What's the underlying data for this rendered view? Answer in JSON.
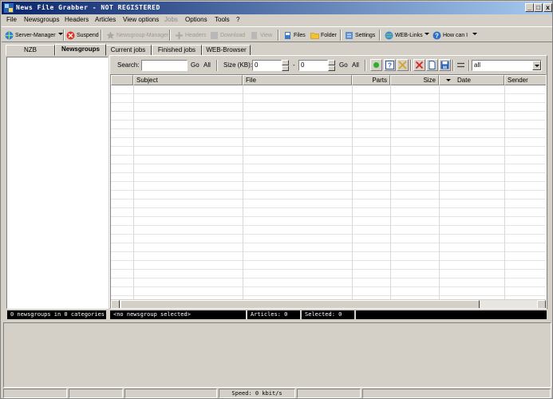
{
  "window": {
    "title": "News File Grabber - NOT REGISTERED",
    "min_label": "_",
    "max_label": "□",
    "close_label": "x"
  },
  "menu": [
    "File",
    "Newsgroups",
    "Headers",
    "Articles",
    "View options",
    "Jobs",
    "Options",
    "Tools",
    "?"
  ],
  "toolbar": {
    "server_manager": "Server-Manager",
    "suspend": "Suspend",
    "newsgroup_manager": "Newsgroup-Manager",
    "headers": "Headers",
    "download": "Download",
    "view": "View",
    "files": "Files",
    "folder": "Folder",
    "settings": "Settings",
    "web_links": "WEB-Links",
    "how_can_i": "How can I"
  },
  "left_tabs": [
    "NZB",
    "Newsgroups"
  ],
  "right_tabs": [
    "Current jobs",
    "Finished jobs",
    "WEB-Browser"
  ],
  "filter": {
    "search_label": "Search:",
    "search_value": "",
    "go1": "Go",
    "all1": "All",
    "size_label": "Size (KB):",
    "size_from": "0",
    "dash": "-",
    "size_to": "0",
    "go2": "Go",
    "all2": "All",
    "select_value": "all"
  },
  "grid": {
    "columns": [
      "Subject",
      "File",
      "Parts",
      "Size",
      "Date",
      "Sender"
    ]
  },
  "status_panels": {
    "newsgroups": "0 newsgroups in 0 categories",
    "selected_group": "<no newsgroup selected>",
    "articles": "Articles: 0",
    "selected": "Selected: 0",
    "extra": ""
  },
  "statusbar": {
    "speed": "Speed: 0 kbit/s"
  },
  "colors": {
    "title_start": "#0a246a",
    "title_end": "#a6caf0",
    "panel_bg": "#d4d0c8"
  }
}
